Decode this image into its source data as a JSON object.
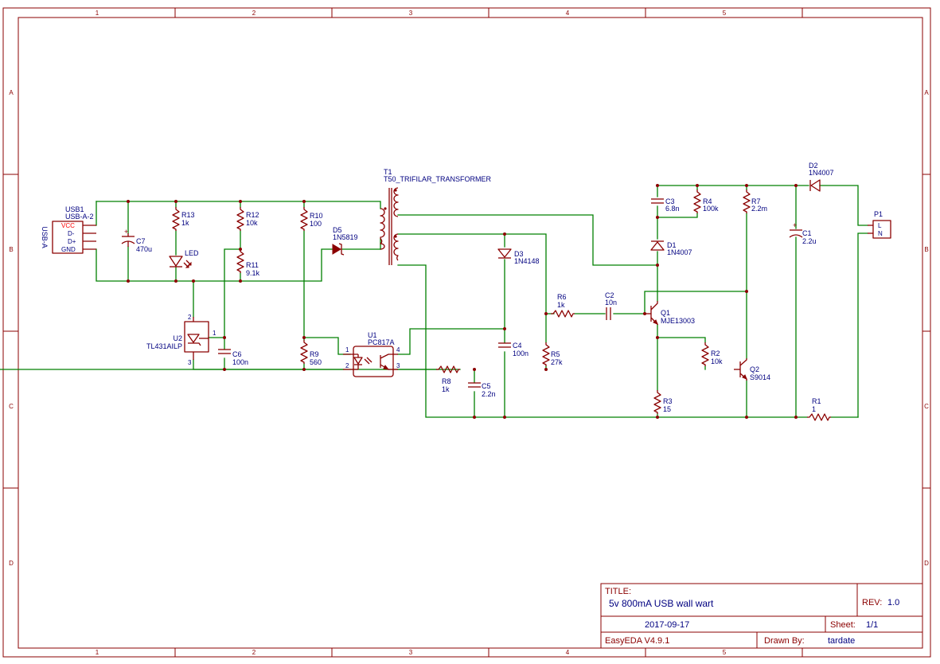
{
  "ruler": {
    "cols": [
      "1",
      "2",
      "3",
      "4",
      "5"
    ],
    "rows": [
      "A",
      "B",
      "C",
      "D"
    ]
  },
  "colors": {
    "frame": "#8b0000",
    "wire": "#008000",
    "component": "#8b0000",
    "text": "#000080",
    "vcc_pin": "#ff0000"
  },
  "components": {
    "usb1": {
      "ref": "USB1",
      "value": "USB-A-2",
      "pins": [
        "VCC",
        "D-",
        "D+",
        "GND"
      ],
      "side_label": "USB-A"
    },
    "c7": {
      "ref": "C7",
      "value": "470u"
    },
    "r13": {
      "ref": "R13",
      "value": "1k"
    },
    "led": {
      "ref": "LED"
    },
    "r12": {
      "ref": "R12",
      "value": "10k"
    },
    "r11": {
      "ref": "R11",
      "value": "9.1k"
    },
    "r10": {
      "ref": "R10",
      "value": "100"
    },
    "d5": {
      "ref": "D5",
      "value": "1N5819"
    },
    "t1": {
      "ref": "T1",
      "value": "T50_TRIFILAR_TRANSFORMER"
    },
    "u2": {
      "ref": "U2",
      "value": "TL431AILP",
      "pins": [
        "1",
        "2",
        "3"
      ]
    },
    "c6": {
      "ref": "C6",
      "value": "100n"
    },
    "r9": {
      "ref": "R9",
      "value": "560"
    },
    "u1": {
      "ref": "U1",
      "value": "PC817A",
      "pins": [
        "1",
        "2",
        "3",
        "4"
      ]
    },
    "r8": {
      "ref": "R8",
      "value": "1k"
    },
    "c5": {
      "ref": "C5",
      "value": "2.2n"
    },
    "d3": {
      "ref": "D3",
      "value": "1N4148"
    },
    "c4": {
      "ref": "C4",
      "value": "100n"
    },
    "r6": {
      "ref": "R6",
      "value": "1k"
    },
    "r5": {
      "ref": "R5",
      "value": "27k"
    },
    "c2": {
      "ref": "C2",
      "value": "10n"
    },
    "c3": {
      "ref": "C3",
      "value": "6.8n"
    },
    "r4": {
      "ref": "R4",
      "value": "100k"
    },
    "d1": {
      "ref": "D1",
      "value": "1N4007"
    },
    "q1": {
      "ref": "Q1",
      "value": "MJE13003"
    },
    "r2": {
      "ref": "R2",
      "value": "10k"
    },
    "r3": {
      "ref": "R3",
      "value": "15"
    },
    "r7": {
      "ref": "R7",
      "value": "2.2m"
    },
    "q2": {
      "ref": "Q2",
      "value": "S9014"
    },
    "d2": {
      "ref": "D2",
      "value": "1N4007"
    },
    "c1": {
      "ref": "C1",
      "value": "2.2u"
    },
    "r1": {
      "ref": "R1",
      "value": "1"
    },
    "p1": {
      "ref": "P1",
      "pins": [
        "L",
        "N"
      ]
    }
  },
  "title_block": {
    "title_label": "TITLE:",
    "title": "5v 800mA USB wall wart",
    "rev_label": "REV:",
    "rev": "1.0",
    "date": "2017-09-17",
    "sheet_label": "Sheet:",
    "sheet": "1/1",
    "tool": "EasyEDA V4.9.1",
    "drawn_label": "Drawn By:",
    "drawn_by": "tardate"
  }
}
